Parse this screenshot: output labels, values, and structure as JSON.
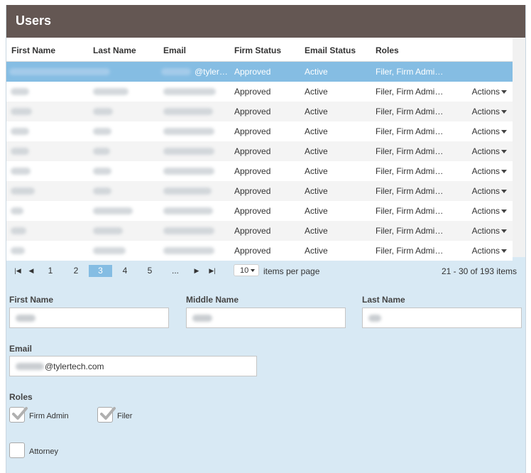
{
  "header": {
    "title": "Users"
  },
  "grid": {
    "columns": [
      "First Name",
      "Last Name",
      "Email",
      "Firm Status",
      "Email Status",
      "Roles"
    ],
    "rows": [
      {
        "email_suffix": "@tyler…",
        "firm_status": "Approved",
        "email_status": "Active",
        "roles": "Filer, Firm Admi…",
        "actions": ""
      },
      {
        "email_suffix": "",
        "firm_status": "Approved",
        "email_status": "Active",
        "roles": "Filer, Firm Admi…",
        "actions": "Actions"
      },
      {
        "email_suffix": "",
        "firm_status": "Approved",
        "email_status": "Active",
        "roles": "Filer, Firm Admi…",
        "actions": "Actions"
      },
      {
        "email_suffix": "",
        "firm_status": "Approved",
        "email_status": "Active",
        "roles": "Filer, Firm Admi…",
        "actions": "Actions"
      },
      {
        "email_suffix": "",
        "firm_status": "Approved",
        "email_status": "Active",
        "roles": "Filer, Firm Admi…",
        "actions": "Actions"
      },
      {
        "email_suffix": "",
        "firm_status": "Approved",
        "email_status": "Active",
        "roles": "Filer, Firm Admi…",
        "actions": "Actions"
      },
      {
        "email_suffix": "",
        "firm_status": "Approved",
        "email_status": "Active",
        "roles": "Filer, Firm Admi…",
        "actions": "Actions"
      },
      {
        "email_suffix": "",
        "firm_status": "Approved",
        "email_status": "Active",
        "roles": "Filer, Firm Admi…",
        "actions": "Actions"
      },
      {
        "email_suffix": "",
        "firm_status": "Approved",
        "email_status": "Active",
        "roles": "Filer, Firm Admi…",
        "actions": "Actions"
      },
      {
        "email_suffix": "",
        "firm_status": "Approved",
        "email_status": "Active",
        "roles": "Filer, Firm Admi…",
        "actions": "Actions"
      }
    ]
  },
  "pager": {
    "pages": [
      "1",
      "2",
      "3",
      "4",
      "5",
      "..."
    ],
    "current_page": "3",
    "page_size": "10",
    "page_size_label": "items per page",
    "range": "21 - 30 of 193 items"
  },
  "form": {
    "first_name_label": "First Name",
    "middle_name_label": "Middle Name",
    "last_name_label": "Last Name",
    "email_label": "Email",
    "email_value": "@tylertech.com",
    "roles_label": "Roles",
    "roles": [
      {
        "label": "Firm Admin",
        "checked": true
      },
      {
        "label": "Filer",
        "checked": true
      },
      {
        "label": "Attorney",
        "checked": false
      }
    ]
  },
  "colors": {
    "header": "#645753",
    "selected": "#85bde3",
    "panel": "#d8e9f4"
  }
}
